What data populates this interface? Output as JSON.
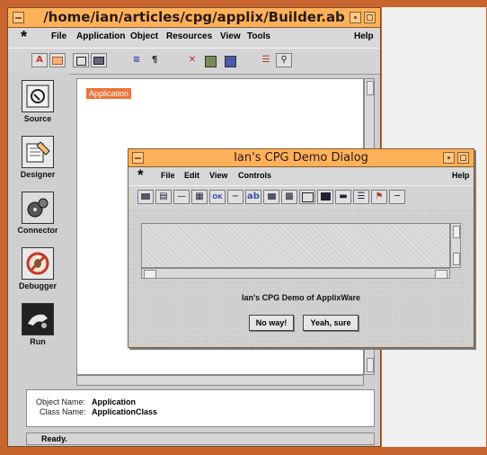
{
  "main_window": {
    "title": "/home/ian/articles/cpg/applix/Builder.ab",
    "menu": [
      "File",
      "Application",
      "Object",
      "Resources",
      "View",
      "Tools"
    ],
    "help": "Help",
    "app_logo": "*",
    "toolbar_icons": [
      "text-style-icon",
      "frame-icon",
      "box-icon",
      "image-icon",
      "align-icon",
      "paragraph-icon",
      "cut-icon",
      "paste-icon",
      "grid-icon",
      "list-icon",
      "find-icon"
    ],
    "palette": [
      {
        "label": "Source",
        "icon": "source-icon"
      },
      {
        "label": "Designer",
        "icon": "designer-icon"
      },
      {
        "label": "Connector",
        "icon": "connector-icon"
      },
      {
        "label": "Debugger",
        "icon": "debugger-icon"
      },
      {
        "label": "Run",
        "icon": "run-icon"
      }
    ],
    "canvas_tag": "Application",
    "object_name_label": "Object Name:",
    "object_name_value": "Application",
    "class_name_label": "Class Name:",
    "class_name_value": "ApplicationClass",
    "status": "Ready."
  },
  "dialog": {
    "title": "Ian's CPG Demo Dialog",
    "menu": [
      "File",
      "Edit",
      "View",
      "Controls"
    ],
    "help": "Help",
    "app_logo": "*",
    "toolbar_icons": [
      "label-icon",
      "listbox-icon",
      "separator-icon",
      "dropdown-icon",
      "ok-button-icon",
      "slider-icon",
      "text-field-icon",
      "image-icon",
      "table-icon",
      "frame-icon",
      "panel-icon",
      "scrollbar-icon",
      "list-icon",
      "tree-icon",
      "line-icon"
    ],
    "ok_text": "OK",
    "ab_text": "ab",
    "message": "Ian's CPG Demo of ApplixWare",
    "button_no": "No way!",
    "button_yes": "Yeah, sure"
  },
  "colors": {
    "background": "#c8642e",
    "titlebar": "#ffb15a",
    "tag": "#e9743a"
  }
}
